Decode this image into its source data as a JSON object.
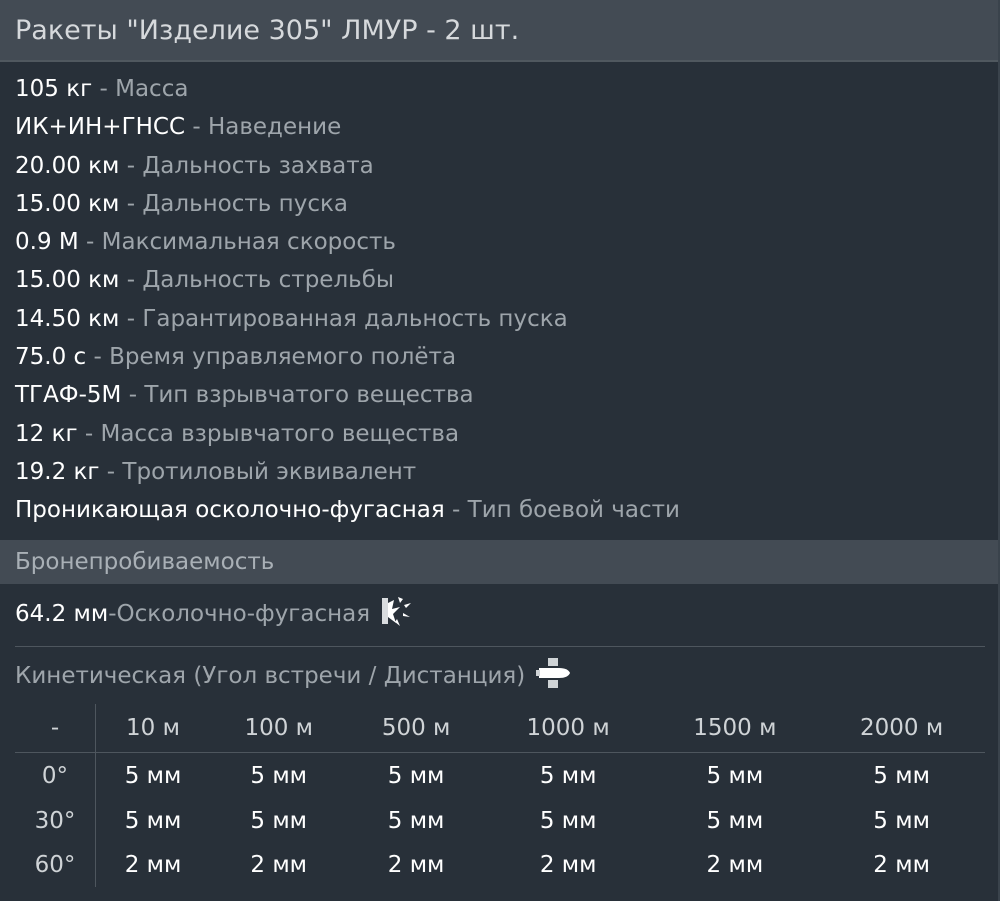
{
  "title": "Ракеты \"Изделие 305\" ЛМУР - 2 шт.",
  "separator": " - ",
  "stats": [
    {
      "value": "105 кг",
      "label": "Масса"
    },
    {
      "value": "ИК+ИН+ГНСС",
      "label": "Наведение"
    },
    {
      "value": "20.00 км",
      "label": "Дальность захвата"
    },
    {
      "value": "15.00 км",
      "label": "Дальность пуска"
    },
    {
      "value": "0.9 М",
      "label": "Максимальная скорость"
    },
    {
      "value": "15.00 км",
      "label": "Дальность стрельбы"
    },
    {
      "value": "14.50 км",
      "label": "Гарантированная дальность пуска"
    },
    {
      "value": "75.0 с",
      "label": "Время управляемого полёта"
    },
    {
      "value": "ТГАФ-5М",
      "label": "Тип взрывчатого вещества"
    },
    {
      "value": "12 кг",
      "label": "Масса взрывчатого вещества"
    },
    {
      "value": "19.2 кг",
      "label": "Тротиловый эквивалент"
    },
    {
      "value": "Проникающая осколочно-фугасная",
      "label": "Тип боевой части"
    }
  ],
  "penetration": {
    "section_title": "Бронепробиваемость",
    "he_value": "64.2 мм",
    "he_label": "Осколочно-фугасная",
    "he_icon": "explosion-icon",
    "kinetic_label": "Кинетическая (Угол встречи / Дистанция)",
    "kinetic_icon": "shell-icon",
    "table": {
      "corner": "-",
      "columns": [
        "10 м",
        "100 м",
        "500 м",
        "1000 м",
        "1500 м",
        "2000 м"
      ],
      "rows": [
        {
          "angle": "0°",
          "values": [
            "5 мм",
            "5 мм",
            "5 мм",
            "5 мм",
            "5 мм",
            "5 мм"
          ]
        },
        {
          "angle": "30°",
          "values": [
            "5 мм",
            "5 мм",
            "5 мм",
            "5 мм",
            "5 мм",
            "5 мм"
          ]
        },
        {
          "angle": "60°",
          "values": [
            "2 мм",
            "2 мм",
            "2 мм",
            "2 мм",
            "2 мм",
            "2 мм"
          ]
        }
      ]
    }
  },
  "colors": {
    "background": "#283039",
    "header": "#434b54",
    "value_text": "#ffffff",
    "label_text": "#9ea5ab"
  }
}
